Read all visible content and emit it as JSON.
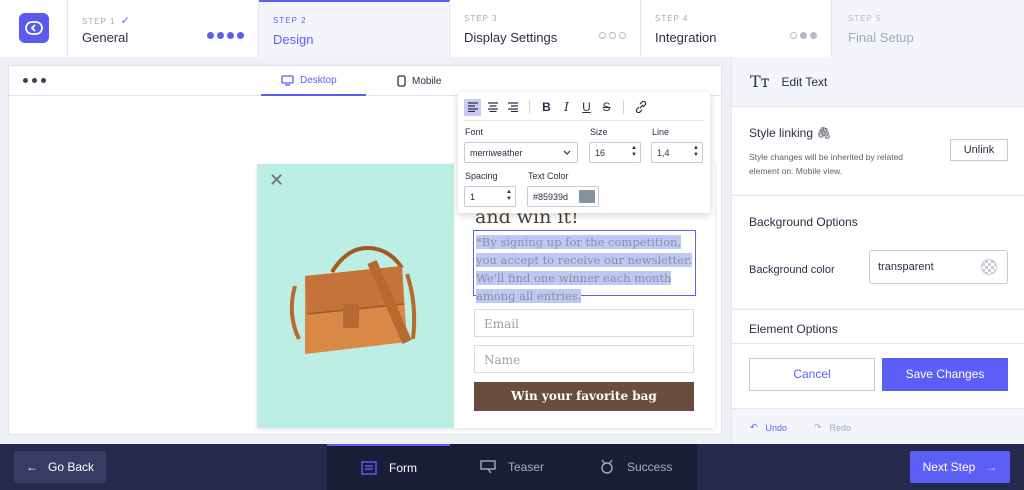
{
  "steps": [
    {
      "num": "STEP 1",
      "check": "✓",
      "name": "General"
    },
    {
      "num": "STEP 2",
      "name": "Design"
    },
    {
      "num": "STEP 3",
      "name": "Display Settings"
    },
    {
      "num": "STEP 4",
      "name": "Integration"
    },
    {
      "num": "STEP 5",
      "name": "Final Setup"
    }
  ],
  "devices": {
    "desktop": "Desktop",
    "mobile": "Mobile"
  },
  "popup": {
    "heading_visible": "and win it!",
    "disclaimer": "*By signing up for the competition, you accept to receive our newsletter. We'll find one winner each month among all entries.",
    "email_placeholder": "Email",
    "name_placeholder": "Name",
    "cta": "Win your favorite bag",
    "close_symbol": "✕"
  },
  "text_toolbar": {
    "font_label": "Font",
    "font_value": "merriweather",
    "size_label": "Size",
    "size_value": "16",
    "line_label": "Line",
    "line_value": "1,4",
    "spacing_label": "Spacing",
    "spacing_value": "1",
    "text_color_label": "Text Color",
    "text_color_value": "#85939d",
    "colors": {
      "text": "#85939d",
      "active_align_bg": "#c9cbf6"
    }
  },
  "right_panel": {
    "title": "Edit Text",
    "style_linking": {
      "title": "Style linking",
      "desc": "Style changes will be inherited by related element on: Mobile view.",
      "unlink": "Unlink"
    },
    "background": {
      "title": "Background Options",
      "label": "Background color",
      "value": "transparent"
    },
    "element_options": "Element Options",
    "cancel": "Cancel",
    "save": "Save Changes",
    "undo": "Undo",
    "redo": "Redo"
  },
  "bottom": {
    "go_back": "Go Back",
    "tabs": [
      "Form",
      "Teaser",
      "Success"
    ],
    "next": "Next Step"
  },
  "colors": {
    "accent": "#5b5ff5",
    "dark_bar": "#252a4c",
    "mint": "#bdeee3",
    "cta_brown": "#6b4d3e"
  }
}
